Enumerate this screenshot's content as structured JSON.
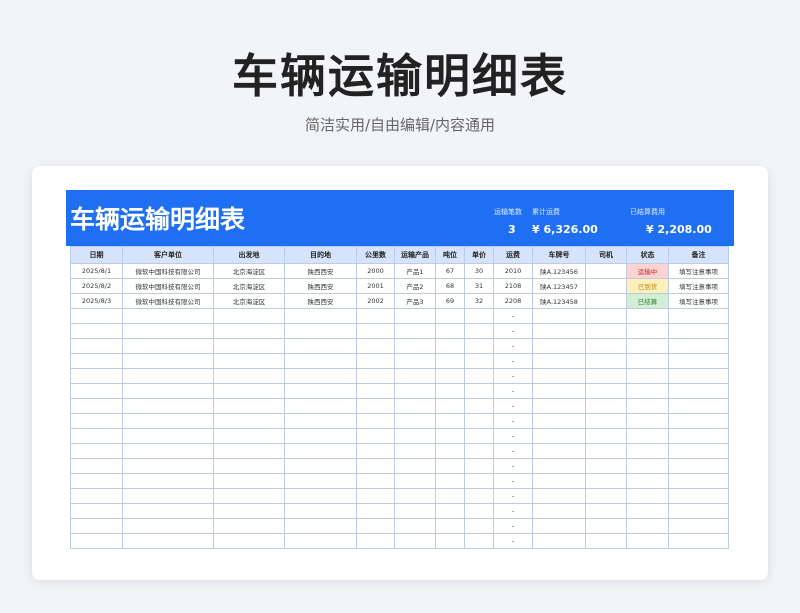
{
  "page": {
    "title": "车辆运输明细表",
    "subtitle": "简洁实用/自由编辑/内容通用"
  },
  "sheet": {
    "banner_title": "车辆运输明细表",
    "stats": [
      {
        "label": "运输笔数",
        "value": "3"
      },
      {
        "label": "累计运费",
        "value": "¥ 6,326.00"
      },
      {
        "label": "已结算费用",
        "value": "¥ 2,208.00"
      }
    ],
    "headers": [
      "日期",
      "客户单位",
      "出发地",
      "目的地",
      "公里数",
      "运输产品",
      "吨位",
      "单价",
      "运费",
      "车牌号",
      "司机",
      "状态",
      "备注"
    ],
    "rows": [
      {
        "date": "2025/8/1",
        "client": "微软中国科技有限公司",
        "origin": "北京海淀区",
        "dest": "陕西西安",
        "km": "2000",
        "product": "产品1",
        "tons": "67",
        "price": "30",
        "fee": "2010",
        "plate": "陕A.123456",
        "driver": "",
        "status": "运输中",
        "status_color": "#fbd3d3",
        "note": "填写注意事项"
      },
      {
        "date": "2025/8/2",
        "client": "微软中国科技有限公司",
        "origin": "北京海淀区",
        "dest": "陕西西安",
        "km": "2001",
        "product": "产品2",
        "tons": "68",
        "price": "31",
        "fee": "2108",
        "plate": "陕A.123457",
        "driver": "",
        "status": "已到货",
        "status_color": "#fdf0b8",
        "note": "填写注意事项"
      },
      {
        "date": "2025/8/3",
        "client": "微软中国科技有限公司",
        "origin": "北京海淀区",
        "dest": "陕西西安",
        "km": "2002",
        "product": "产品3",
        "tons": "69",
        "price": "32",
        "fee": "2208",
        "plate": "陕A.123458",
        "driver": "",
        "status": "已结算",
        "status_color": "#d2efd5",
        "note": "填写注意事项"
      }
    ],
    "empty_row_fee": "-",
    "empty_row_count": 16
  }
}
